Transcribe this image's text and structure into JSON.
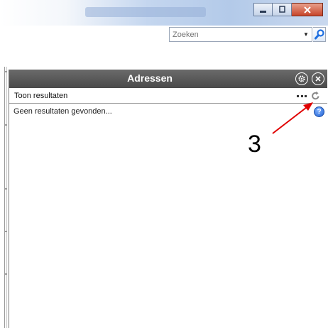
{
  "search": {
    "placeholder": "Zoeken"
  },
  "panel": {
    "title": "Adressen",
    "toolbar_label": "Toon resultaten",
    "results_text": "Geen resultaten gevonden...",
    "help_label": "?"
  },
  "annotation": {
    "number": "3",
    "color": "#e00000"
  },
  "icons": {
    "settings": "gear-icon",
    "close": "close-circle-icon",
    "more": "more-dots-icon",
    "refresh": "refresh-icon",
    "help": "help-icon",
    "search": "search-icon"
  },
  "colors": {
    "header_bg": "#555555",
    "close_button": "#c7452a",
    "help_blue": "#1f5fd1"
  }
}
